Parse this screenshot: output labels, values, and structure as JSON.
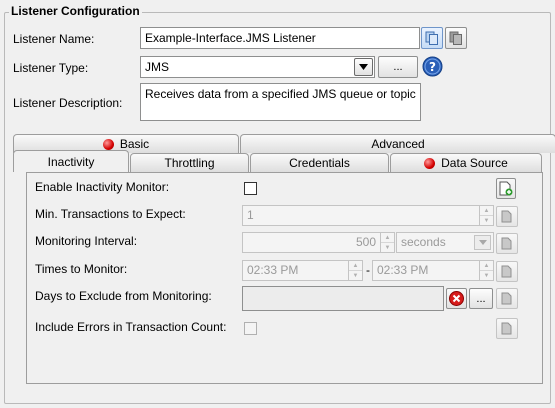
{
  "group": {
    "title": "Listener Configuration"
  },
  "form": {
    "name_label": "Listener Name:",
    "name_value": "Example-Interface.JMS Listener",
    "type_label": "Listener Type:",
    "type_value": "JMS",
    "type_browse": "...",
    "desc_label": "Listener Description:",
    "desc_value": "Receives data from a specified JMS queue or topic"
  },
  "tabs": {
    "row_back": [
      {
        "label": "Basic",
        "error": true
      },
      {
        "label": "Advanced",
        "error": false
      }
    ],
    "row_front": [
      {
        "label": "Inactivity",
        "selected": true
      },
      {
        "label": "Throttling"
      },
      {
        "label": "Credentials"
      },
      {
        "label": "Data Source",
        "error": true
      }
    ]
  },
  "inactivity": {
    "enable_label": "Enable Inactivity Monitor:",
    "min_label": "Min. Transactions to Expect:",
    "min_value": "1",
    "interval_label": "Monitoring Interval:",
    "interval_value": "500",
    "interval_unit": "seconds",
    "times_label": "Times to Monitor:",
    "time_start": "02:33 PM",
    "time_sep": "-",
    "time_end": "02:33 PM",
    "days_label": "Days to Exclude from Monitoring:",
    "days_browse": "...",
    "errors_label": "Include Errors in Transaction Count:"
  }
}
